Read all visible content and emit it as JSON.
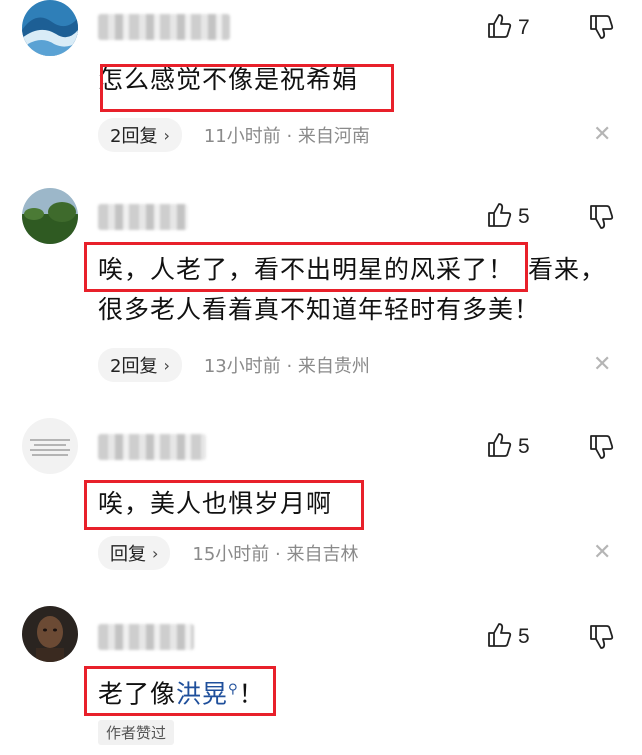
{
  "comments": [
    {
      "likes": "7",
      "text": "怎么感觉不像是祝希娟",
      "reply_label": "2回复",
      "meta": "11小时前 · 来自河南"
    },
    {
      "likes": "5",
      "text_line1_hl": "唉，人老了，看不出明星的风采了！",
      "text_line1_rest": "看来，",
      "text_line2": "很多老人看着真不知道年轻时有多美！",
      "reply_label": "2回复",
      "meta": "13小时前 · 来自贵州"
    },
    {
      "likes": "5",
      "text": "唉，美人也惧岁月啊",
      "reply_label": "回复",
      "meta": "15小时前 · 来自吉林"
    },
    {
      "likes": "5",
      "text_before": "老了像",
      "link_text": "洪晃",
      "text_after": "！",
      "badge": "作者赞过"
    }
  ],
  "icons": {
    "like": "thumb-up-icon",
    "dislike": "thumb-down-icon",
    "chevron": "›",
    "close": "×",
    "search": "search-icon"
  },
  "colors": {
    "highlight_border": "#e8202a",
    "link": "#1f4f9b",
    "meta": "#8a8a8a"
  }
}
